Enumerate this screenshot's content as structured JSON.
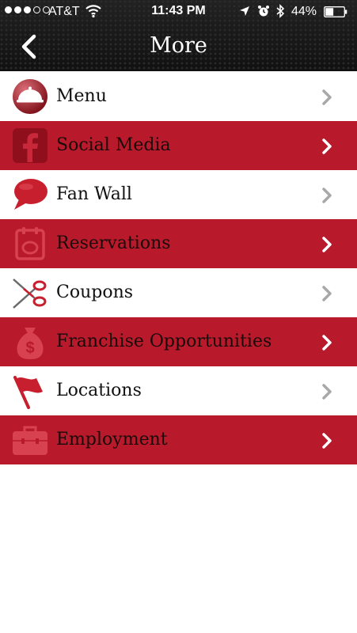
{
  "status_bar": {
    "signal_dots_filled": 3,
    "signal_dots_total": 5,
    "carrier": "AT&T",
    "time": "11:43 PM",
    "battery_percent": "44%",
    "battery_level": 0.44,
    "icons": [
      "wifi-icon",
      "location-arrow-icon",
      "alarm-icon",
      "bluetooth-icon",
      "battery-icon"
    ]
  },
  "nav": {
    "title": "More",
    "back_icon": "chevron-left-icon"
  },
  "colors": {
    "accent_red": "#b81a2b",
    "bar_dark": "#1a1a1a",
    "chevron_white_row": "#a8a8a8",
    "chevron_red_row": "#ffffff"
  },
  "items": [
    {
      "label": "Menu",
      "icon": "cloche-icon",
      "style": "white"
    },
    {
      "label": "Social Media",
      "icon": "facebook-icon",
      "style": "red"
    },
    {
      "label": "Fan Wall",
      "icon": "speech-bubble-icon",
      "style": "white"
    },
    {
      "label": "Reservations",
      "icon": "calendar-icon",
      "style": "red"
    },
    {
      "label": "Coupons",
      "icon": "scissors-icon",
      "style": "white"
    },
    {
      "label": "Franchise Opportunities",
      "icon": "money-bag-icon",
      "style": "red"
    },
    {
      "label": "Locations",
      "icon": "flag-icon",
      "style": "white"
    },
    {
      "label": "Employment",
      "icon": "briefcase-icon",
      "style": "red"
    }
  ]
}
